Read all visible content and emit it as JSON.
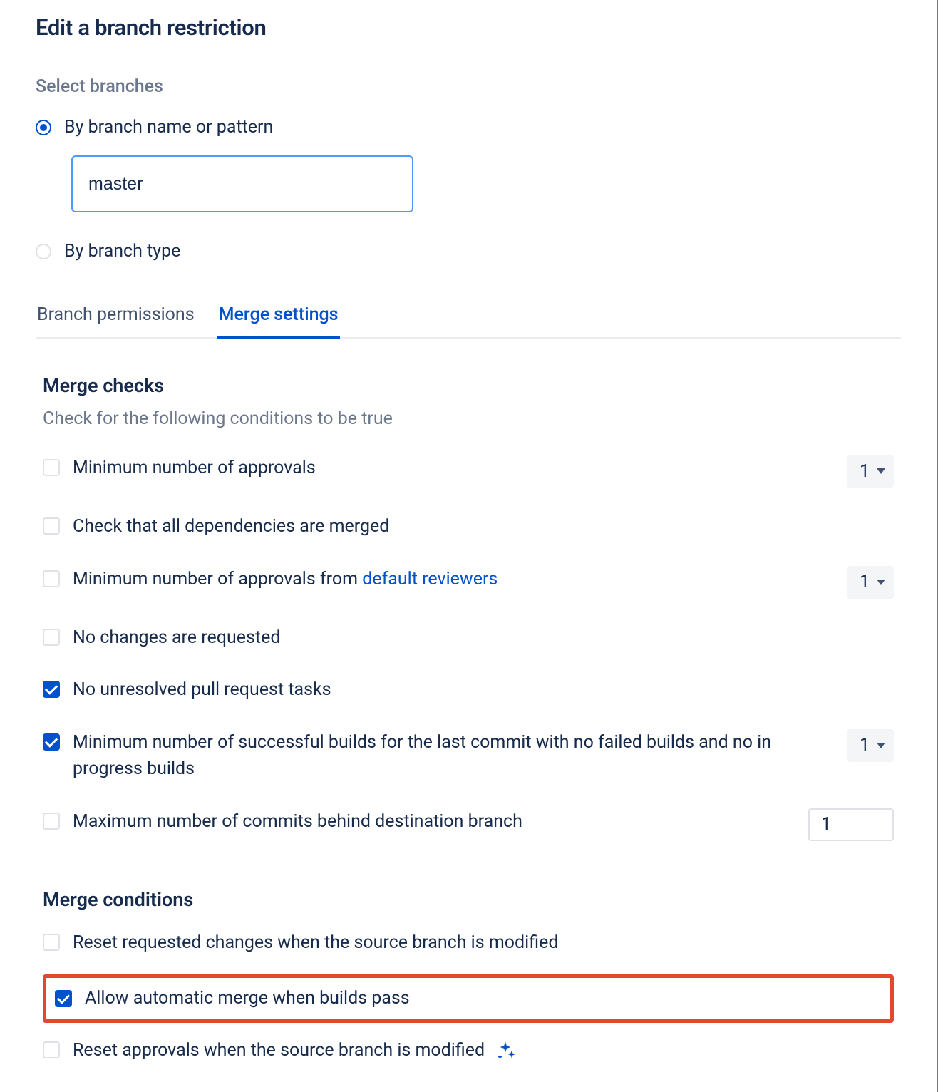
{
  "title": "Edit a branch restriction",
  "select_branches_label": "Select branches",
  "radio_options": {
    "by_name_label": "By branch name or pattern",
    "by_type_label": "By branch type"
  },
  "branch_name_value": "master",
  "tabs": {
    "branch_permissions": "Branch permissions",
    "merge_settings": "Merge settings"
  },
  "merge_checks": {
    "heading": "Merge checks",
    "description": "Check for the following conditions to be true",
    "min_approvals_label": "Minimum number of approvals",
    "min_approvals_value": "1",
    "dependencies_label": "Check that all dependencies are merged",
    "min_default_reviewers_prefix": "Minimum number of approvals from ",
    "min_default_reviewers_link": "default reviewers",
    "min_default_reviewers_value": "1",
    "no_changes_label": "No changes are requested",
    "no_unresolved_label": "No unresolved pull request tasks",
    "min_builds_label": "Minimum number of successful builds for the last commit with no failed builds and no in progress builds",
    "min_builds_value": "1",
    "max_commits_behind_label": "Maximum number of commits behind destination branch",
    "max_commits_behind_value": "1"
  },
  "merge_conditions": {
    "heading": "Merge conditions",
    "reset_requested_label": "Reset requested changes when the source branch is modified",
    "allow_auto_merge_label": "Allow automatic merge when builds pass",
    "reset_approvals_label": "Reset approvals when the source branch is modified"
  }
}
